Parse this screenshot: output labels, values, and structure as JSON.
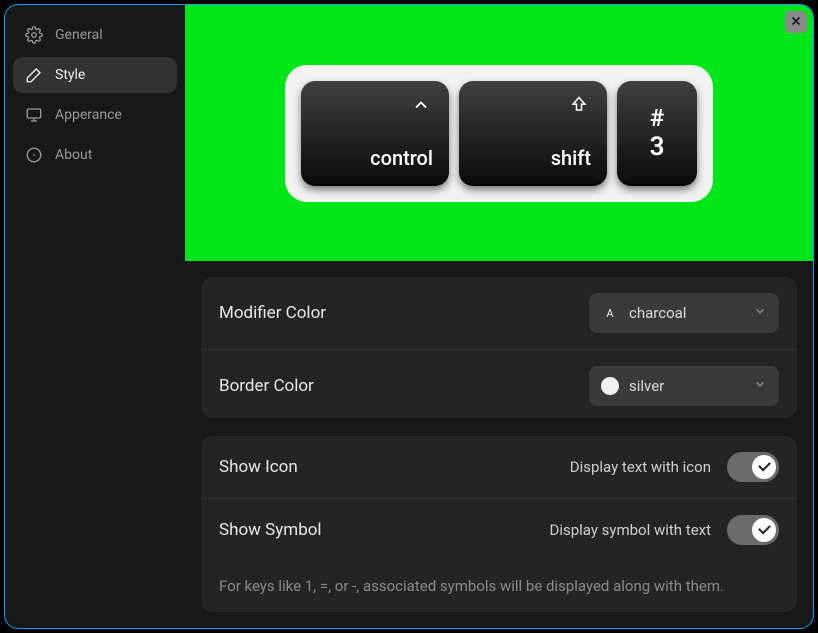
{
  "sidebar": {
    "items": [
      {
        "label": "General"
      },
      {
        "label": "Style"
      },
      {
        "label": "Apperance"
      },
      {
        "label": "About"
      }
    ],
    "active_index": 1
  },
  "preview": {
    "keys": [
      {
        "label": "control",
        "icon": "chevron-up"
      },
      {
        "label": "shift",
        "icon": "up-arrow-outline"
      }
    ],
    "square_key": {
      "symbol": "#",
      "number": "3"
    }
  },
  "settings": {
    "modifier_color": {
      "label": "Modifier Color",
      "value": "charcoal",
      "swatch_mode": "letter",
      "swatch_letter": "A"
    },
    "border_color": {
      "label": "Border Color",
      "value": "silver",
      "swatch_mode": "circle",
      "swatch_hex": "#f0f0f0"
    },
    "show_icon": {
      "label": "Show Icon",
      "sublabel": "Display text with icon",
      "on": true
    },
    "show_symbol": {
      "label": "Show Symbol",
      "sublabel": "Display symbol with text",
      "on": true,
      "help": "For keys like 1, =, or -, associated symbols will be displayed along with them."
    }
  }
}
